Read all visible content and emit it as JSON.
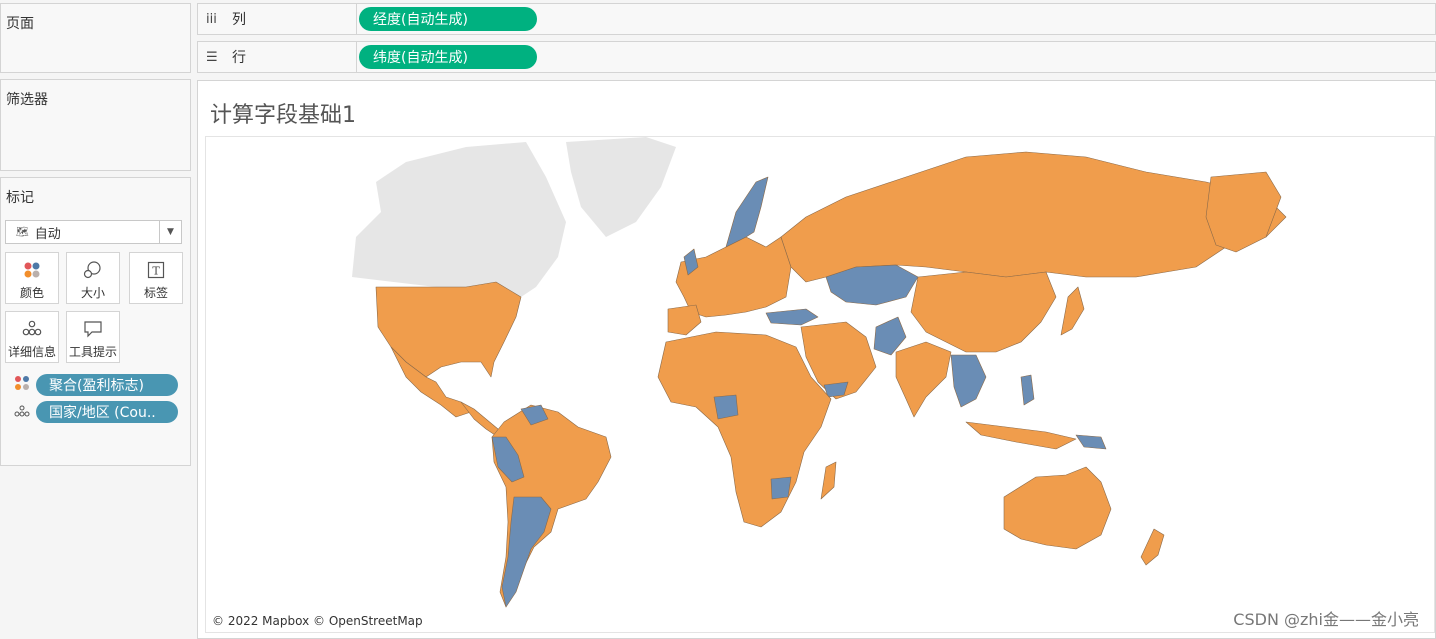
{
  "sidebar": {
    "pages_label": "页面",
    "filters_label": "筛选器",
    "marks_label": "标记",
    "mark_type": "自动",
    "mark_buttons": {
      "color": "颜色",
      "size": "大小",
      "label": "标签",
      "detail": "详细信息",
      "tooltip": "工具提示"
    },
    "mark_fields": [
      "聚合(盈利标志)",
      "国家/地区 (Cou.."
    ]
  },
  "shelves": {
    "columns": {
      "label": "列",
      "pill": "经度(自动生成)"
    },
    "rows": {
      "label": "行",
      "pill": "纬度(自动生成)"
    }
  },
  "viz": {
    "title": "计算字段基础1",
    "attribution": "© 2022 Mapbox © OpenStreetMap",
    "watermark": "CSDN @zhi金——金小亮"
  },
  "colors": {
    "profit_positive": "#f09d4c",
    "profit_negative": "#6a8db5",
    "pill_green": "#00b180",
    "pill_blue": "#4996b2",
    "unmapped_land": "#e6e6e6"
  }
}
